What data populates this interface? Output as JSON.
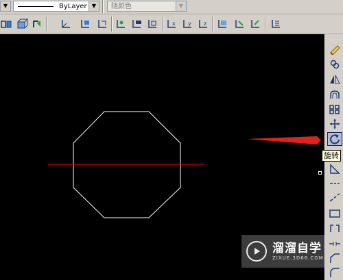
{
  "top_toolbar": {
    "linetype_value": "ByLayer",
    "color_value": "随颜色"
  },
  "tooltip": {
    "text": "旋转"
  },
  "watermark": {
    "title": "溜溜自学",
    "subtitle": "ZIXUE.3D66.COM"
  },
  "colors": {
    "canvas_bg": "#000000",
    "octagon_stroke": "#ffffff",
    "line_stroke": "#ff0000",
    "arrow": "#e41f1f",
    "toolbar_bg": "#d4d0c8"
  },
  "right_toolbar_items": [
    "erase-icon",
    "copy-icon",
    "mirror-icon",
    "offset-icon",
    "array-icon",
    "move-icon",
    "rotate-icon",
    "scale-icon",
    "stretch-icon",
    "lengthen-icon",
    "trim-icon",
    "extend-icon",
    "break-icon",
    "join-icon",
    "chamfer-icon",
    "fillet-icon"
  ]
}
